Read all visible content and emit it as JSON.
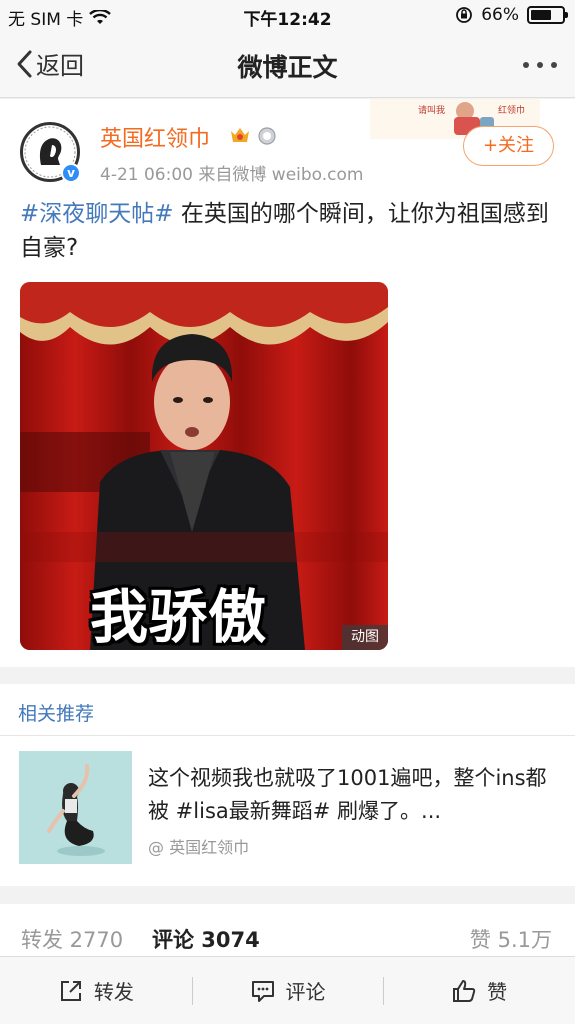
{
  "status_bar": {
    "carrier": "无 SIM 卡",
    "time": "下午12:42",
    "battery": "66%",
    "battery_level": 0.66
  },
  "nav": {
    "back_label": "返回",
    "title": "微博正文"
  },
  "post": {
    "username": "英国红领巾",
    "meta": "4-21 06:00  来自微博 weibo.com",
    "follow_label": "+关注",
    "hashtag": "#深夜聊天帖#",
    "text": " 在英国的哪个瞬间，让你为祖国感到自豪?",
    "gif_caption": "我骄傲",
    "gif_label": "动图",
    "banner_text": "请叫我 红领巾"
  },
  "related": {
    "title": "相关推荐",
    "item_text": "这个视频我也就吸了1001遍吧，整个ins都被 #lisa最新舞蹈# 刷爆了。...",
    "item_source": "@ 英国红领巾"
  },
  "stats": {
    "repost": "转发 2770",
    "comment": "评论 3074",
    "like": "赞 5.1万"
  },
  "toolbar": {
    "repost": "转发",
    "comment": "评论",
    "like": "赞"
  },
  "colors": {
    "accent": "#f36b21",
    "link": "#4479bb",
    "verified": "#2f8ef5"
  }
}
